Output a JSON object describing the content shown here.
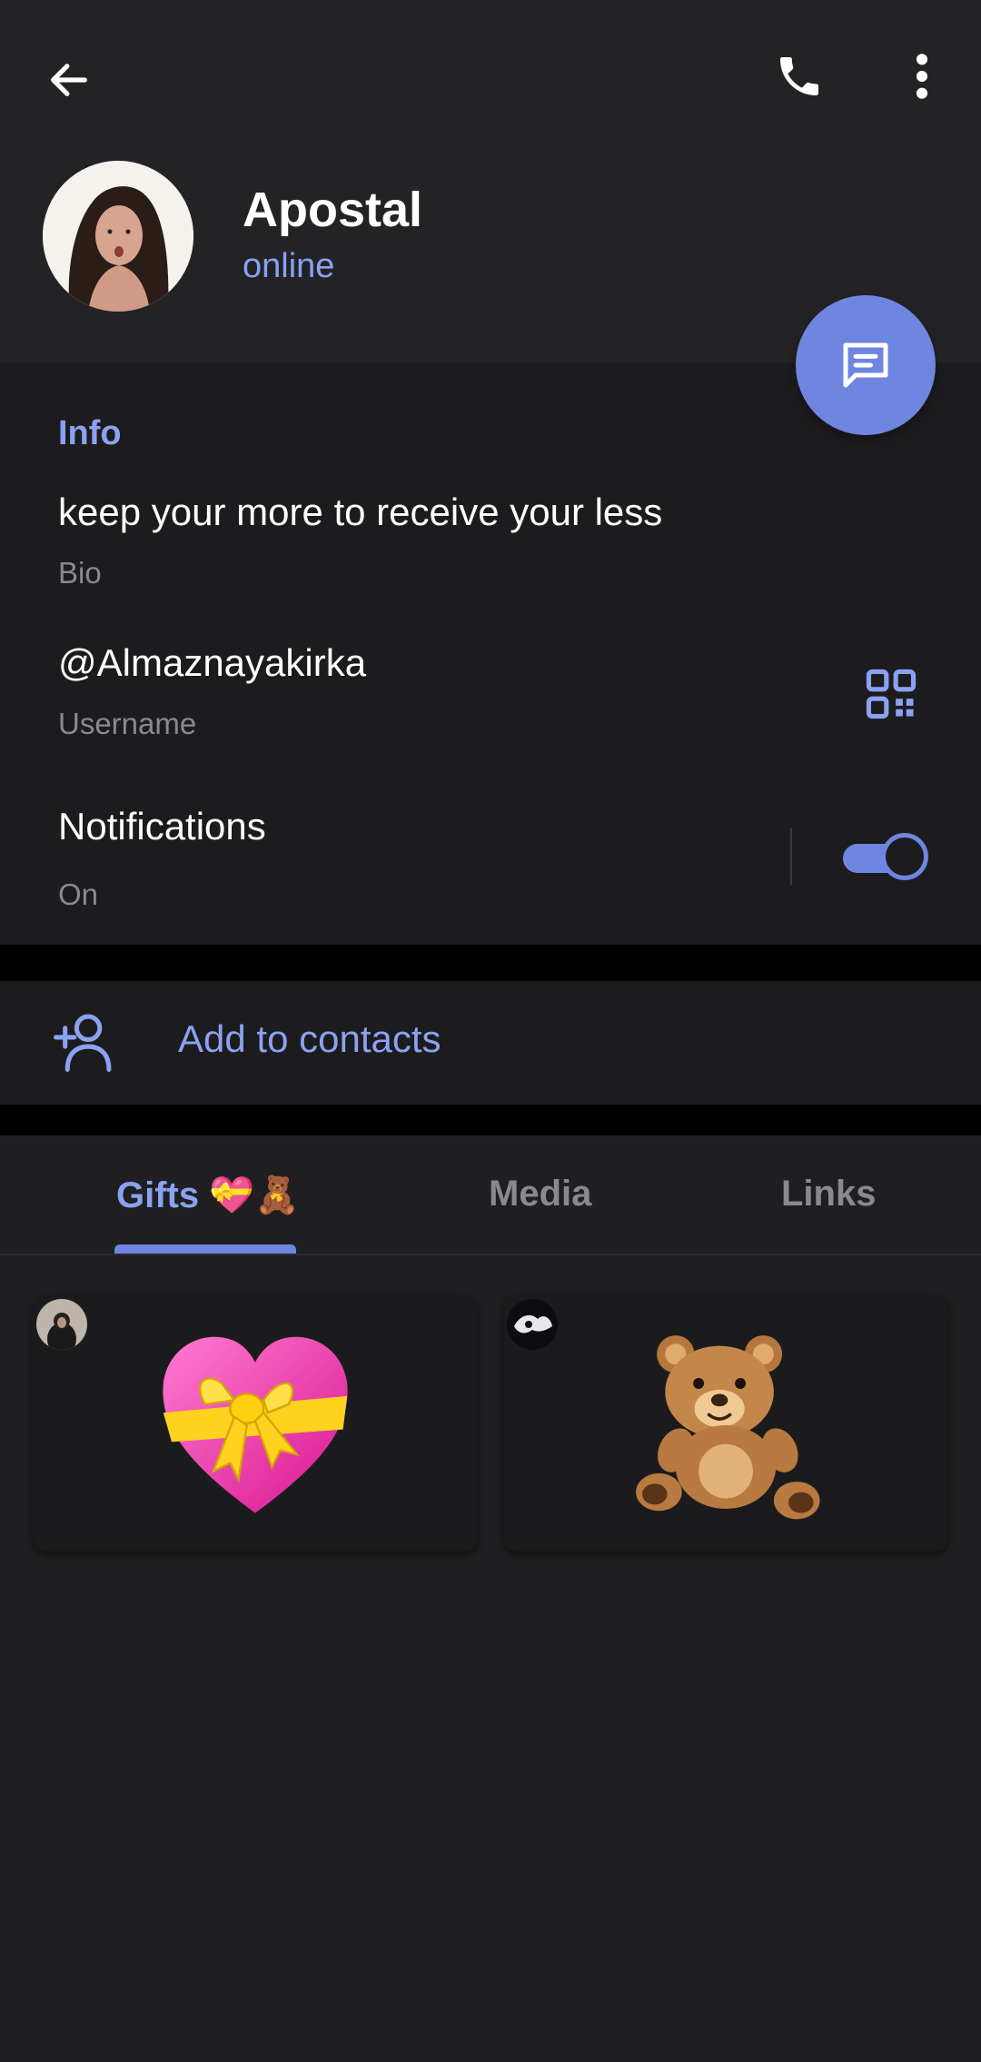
{
  "header": {
    "name": "Apostal",
    "status": "online",
    "icons": [
      "arrow-left-icon",
      "phone-icon",
      "more-vertical-icon",
      "message-icon"
    ]
  },
  "info": {
    "title": "Info",
    "bio": {
      "value": "keep your more to receive your less",
      "label": "Bio"
    },
    "username": {
      "value": "@Almaznayakirka",
      "label": "Username"
    },
    "notifications": {
      "value": "Notifications",
      "label": "On",
      "enabled": true
    }
  },
  "actions": {
    "add_contact_label": "Add to contacts"
  },
  "tabs": [
    {
      "label": "Gifts 💝🧸",
      "active": true
    },
    {
      "label": "Media",
      "active": false
    },
    {
      "label": "Links",
      "active": false
    }
  ],
  "gifts": [
    {
      "emoji": "heart-with-ribbon",
      "sender": "sender-avatar-1"
    },
    {
      "emoji": "teddy-bear",
      "sender": "sender-avatar-2"
    }
  ],
  "colors": {
    "accent": "#6f86e0",
    "accent_text": "#8ba2f2",
    "background": "#1f1f21",
    "surface": "#1c1c1e",
    "muted_text": "#8a8a8e"
  }
}
